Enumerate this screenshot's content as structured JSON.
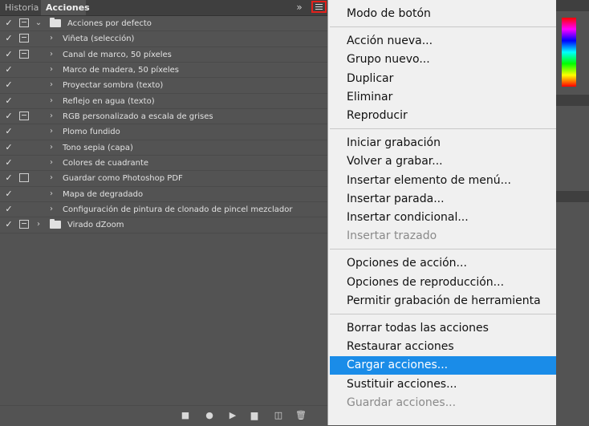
{
  "tabs": [
    {
      "label": "Historia",
      "active": false
    },
    {
      "label": "Acciones",
      "active": true
    }
  ],
  "panel_icons": {
    "collapse": "double-chevron-right-icon",
    "menu": "hamburger-menu-icon"
  },
  "actions": [
    {
      "label": "Acciones por defecto",
      "checked": true,
      "dialog": "on",
      "expanded": true,
      "folder": true,
      "level": 0
    },
    {
      "label": "Viñeta (selección)",
      "checked": true,
      "dialog": "on",
      "level": 1
    },
    {
      "label": "Canal de marco, 50 píxeles",
      "checked": true,
      "dialog": "on",
      "level": 1
    },
    {
      "label": "Marco de madera, 50 píxeles",
      "checked": true,
      "dialog": "none",
      "level": 1
    },
    {
      "label": "Proyectar sombra (texto)",
      "checked": true,
      "dialog": "none",
      "level": 1
    },
    {
      "label": "Reflejo en agua (texto)",
      "checked": true,
      "dialog": "none",
      "level": 1
    },
    {
      "label": "RGB personalizado a escala de grises",
      "checked": true,
      "dialog": "on",
      "level": 1
    },
    {
      "label": "Plomo fundido",
      "checked": true,
      "dialog": "none",
      "level": 1
    },
    {
      "label": "Tono sepia (capa)",
      "checked": true,
      "dialog": "none",
      "level": 1
    },
    {
      "label": "Colores de cuadrante",
      "checked": true,
      "dialog": "none",
      "level": 1
    },
    {
      "label": "Guardar como Photoshop PDF",
      "checked": true,
      "dialog": "box",
      "level": 1
    },
    {
      "label": "Mapa de degradado",
      "checked": true,
      "dialog": "none",
      "level": 1
    },
    {
      "label": "Configuración de pintura de clonado de pincel mezclador",
      "checked": true,
      "dialog": "none",
      "level": 1
    },
    {
      "label": "Virado dZoom",
      "checked": true,
      "dialog": "on",
      "expanded": false,
      "folder": true,
      "level": 0
    }
  ],
  "bottom_icons": [
    "stop-icon",
    "record-icon",
    "play-icon",
    "new-set-folder-icon",
    "new-action-icon",
    "trash-icon"
  ],
  "menu": {
    "groups": [
      [
        {
          "label": "Modo de botón",
          "enabled": true
        }
      ],
      [
        {
          "label": "Acción nueva...",
          "enabled": true
        },
        {
          "label": "Grupo nuevo...",
          "enabled": true
        },
        {
          "label": "Duplicar",
          "enabled": true
        },
        {
          "label": "Eliminar",
          "enabled": true
        },
        {
          "label": "Reproducir",
          "enabled": true
        }
      ],
      [
        {
          "label": "Iniciar grabación",
          "enabled": true
        },
        {
          "label": "Volver a grabar...",
          "enabled": true
        },
        {
          "label": "Insertar elemento de menú...",
          "enabled": true
        },
        {
          "label": "Insertar parada...",
          "enabled": true
        },
        {
          "label": "Insertar condicional...",
          "enabled": true
        },
        {
          "label": "Insertar trazado",
          "enabled": false
        }
      ],
      [
        {
          "label": "Opciones de acción...",
          "enabled": true
        },
        {
          "label": "Opciones de reproducción...",
          "enabled": true
        },
        {
          "label": "Permitir grabación de herramienta",
          "enabled": true
        }
      ],
      [
        {
          "label": "Borrar todas las acciones",
          "enabled": true
        },
        {
          "label": "Restaurar acciones",
          "enabled": true
        },
        {
          "label": "Cargar acciones...",
          "enabled": true,
          "highlighted": true
        },
        {
          "label": "Sustituir acciones...",
          "enabled": true
        },
        {
          "label": "Guardar acciones...",
          "enabled": false
        }
      ]
    ]
  },
  "colors": {
    "highlight": "#1a8ce8",
    "annotation_box": "#e2211c",
    "panel_bg": "#535353",
    "menu_bg": "#f0f0f0"
  }
}
